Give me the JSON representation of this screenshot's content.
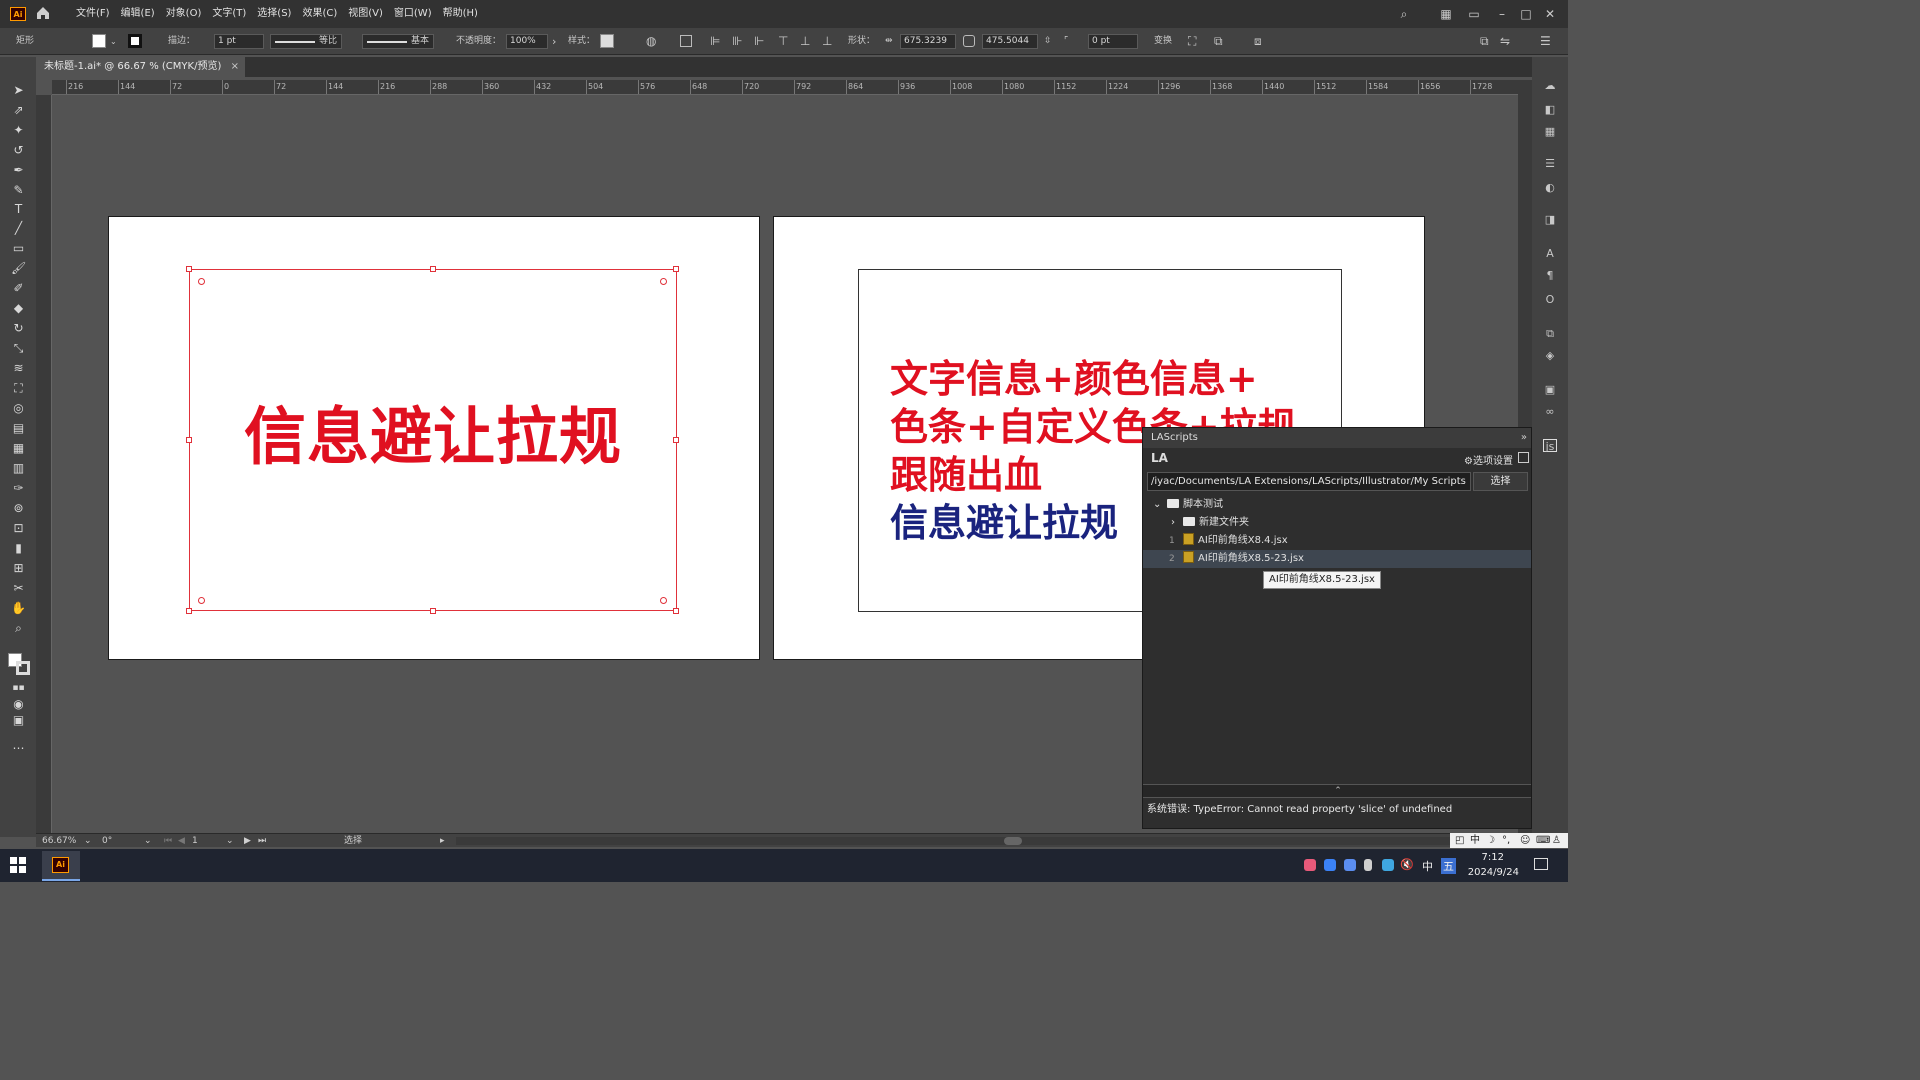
{
  "app": {
    "logo_text": "Ai",
    "menus": [
      "文件(F)",
      "编辑(E)",
      "对象(O)",
      "文字(T)",
      "选择(S)",
      "效果(C)",
      "视图(V)",
      "窗口(W)",
      "帮助(H)"
    ]
  },
  "control_bar": {
    "object_type": "矩形",
    "stroke_label": "描边：",
    "stroke_value": "1 pt",
    "stroke_profile": "等比",
    "brush": "基本",
    "opacity_label": "不透明度：",
    "opacity_value": "100%",
    "style_label": "样式：",
    "shape_label": "形状：",
    "width_value": "675.3239",
    "height_value": "475.5044",
    "corner_value": "0 pt",
    "transform_label": "变换"
  },
  "document_tab": {
    "title": "未标题-1.ai* @ 66.67 % (CMYK/预览)",
    "close": "×"
  },
  "ruler_top": [
    "216",
    "144",
    "72",
    "0",
    "72",
    "144",
    "216",
    "288",
    "360",
    "432",
    "504",
    "576",
    "648",
    "720",
    "792",
    "864",
    "936",
    "1008",
    "1080",
    "1152",
    "1224",
    "1296",
    "1368",
    "1440",
    "1512",
    "1584",
    "1656",
    "1728"
  ],
  "artboard1": {
    "text": "信息避让拉规",
    "text_color": "#e01020"
  },
  "artboard2": {
    "lines": [
      {
        "text": "文字信息+颜色信息+",
        "color": "#e01020"
      },
      {
        "text": "色条+自定义色条+拉规",
        "color": "#e01020"
      },
      {
        "text": "跟随出血",
        "color": "#e01020"
      },
      {
        "text": "信息避让拉规",
        "color": "#1a237e"
      }
    ]
  },
  "lascripts_panel": {
    "title": "LAScripts",
    "collapse": "»",
    "logo": "LA",
    "options_button": "⚙选项设置",
    "path": "/iyac/Documents/LA Extensions/LAScripts/Illustrator/My Scripts",
    "choose_button": "选择",
    "tree": {
      "root": "脚本测试",
      "items": [
        {
          "num": "",
          "label": "新建文件夹",
          "kind": "folder"
        },
        {
          "num": "1",
          "label": "AI印前角线X8.4.jsx",
          "kind": "file"
        },
        {
          "num": "2",
          "label": "AI印前角线X8.5-23.jsx",
          "kind": "file"
        }
      ]
    },
    "tooltip": "AI印前角线X8.5-23.jsx",
    "splitter": "⌃",
    "error": "系统错误: TypeError: Cannot read property 'slice' of undefined"
  },
  "status_bar": {
    "zoom": "66.67%",
    "rotation": "0°",
    "page": "1",
    "tool": "选择"
  },
  "taskbar": {
    "ai_label": "Ai",
    "ime1": "中",
    "ime2": "五",
    "time": "7:12",
    "date": "2024/9/24"
  },
  "ime_bar": {
    "mode": "中"
  },
  "colors": {
    "accent_red": "#e01020",
    "accent_navy": "#1a237e",
    "selection": "#e0313a"
  }
}
